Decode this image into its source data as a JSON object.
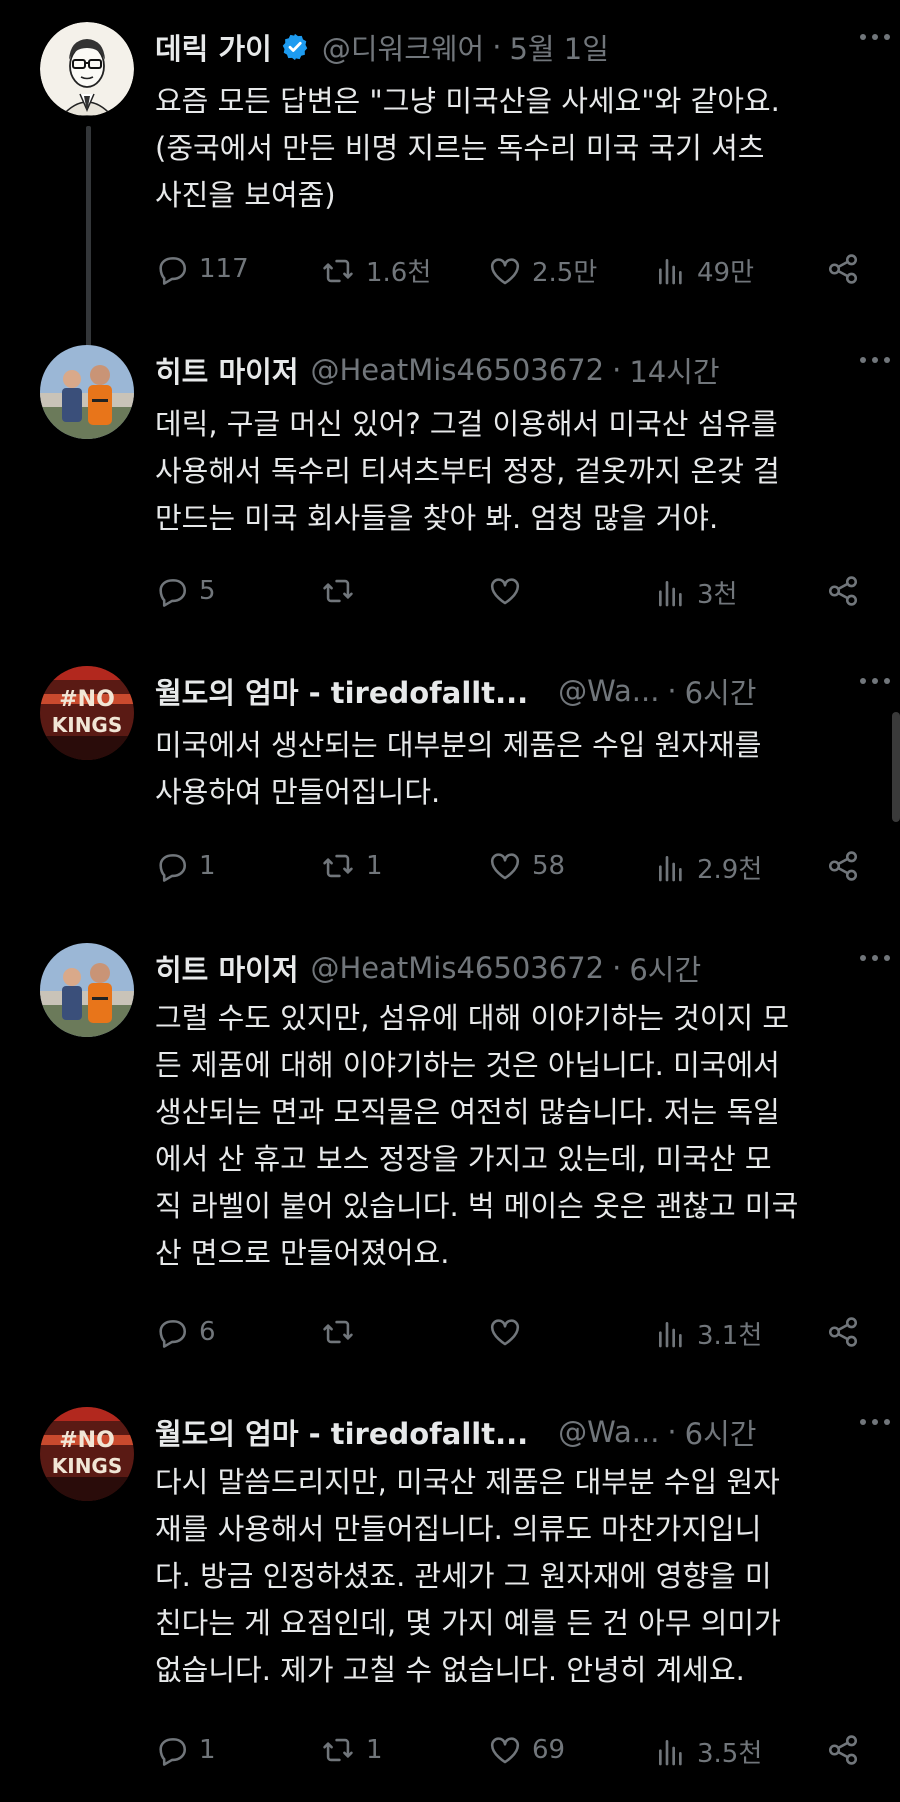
{
  "tweets": [
    {
      "name": "데릭 가이",
      "handle": "@디워크웨어",
      "time": "5월 1일",
      "verified": true,
      "text": "요즘 모든 답변은 \"그냥 미국산을 사세요\"와 같아요.\n(중국에서 만든 비명 지르는 독수리 미국 국기 셔츠\n사진을 보여줌)",
      "replies": "117",
      "retweets": "1.6천",
      "likes": "2.5만",
      "views": "49만"
    },
    {
      "name": "히트 마이저",
      "handle": "@HeatMis46503672",
      "time": "14시간",
      "verified": false,
      "text": "데릭, 구글 머신 있어? 그걸 이용해서 미국산 섬유를\n사용해서 독수리 티셔츠부터 정장, 겉옷까지 온갖 걸\n만드는 미국 회사들을 찾아 봐. 엄청 많을 거야.",
      "replies": "5",
      "retweets": "",
      "likes": "",
      "views": "3천"
    },
    {
      "name": "월도의 엄마 - tiredofallt...",
      "handle": "@Wa...",
      "time": "6시간",
      "verified": false,
      "text": "미국에서 생산되는 대부분의 제품은 수입 원자재를\n사용하여 만들어집니다.",
      "replies": "1",
      "retweets": "1",
      "likes": "58",
      "views": "2.9천"
    },
    {
      "name": "히트 마이저",
      "handle": "@HeatMis46503672",
      "time": "6시간",
      "verified": false,
      "text": "그럴 수도 있지만, 섬유에 대해 이야기하는 것이지 모\n든 제품에 대해 이야기하는 것은 아닙니다. 미국에서\n생산되는 면과 모직물은 여전히 많습니다. 저는 독일\n에서 산 휴고 보스 정장을 가지고 있는데, 미국산 모\n직 라벨이 붙어 있습니다. 벅 메이슨 옷은 괜찮고 미국\n산 면으로 만들어졌어요.",
      "replies": "6",
      "retweets": "",
      "likes": "",
      "views": "3.1천"
    },
    {
      "name": "월도의 엄마 - tiredofallt...",
      "handle": "@Wa...",
      "time": "6시간",
      "verified": false,
      "text": "다시 말씀드리지만, 미국산 제품은 대부분 수입 원자\n재를 사용해서 만들어집니다. 의류도 마찬가지입니\n다. 방금 인정하셨죠. 관세가 그 원자재에 영향을 미\n친다는 게 요점인데, 몇 가지 예를 든 건 아무 의미가\n없습니다. 제가 고칠 수 없습니다. 안녕히 계세요.",
      "replies": "1",
      "retweets": "1",
      "likes": "69",
      "views": "3.5천"
    }
  ],
  "avatars": {
    "t3_text": "#NO KINGS",
    "t5_text": "#NO KINGS"
  },
  "colors": {
    "background": "#000000",
    "text": "#e7e9ea",
    "muted": "#71767b",
    "verified": "#1d9bf0",
    "thread_line": "#333639"
  }
}
